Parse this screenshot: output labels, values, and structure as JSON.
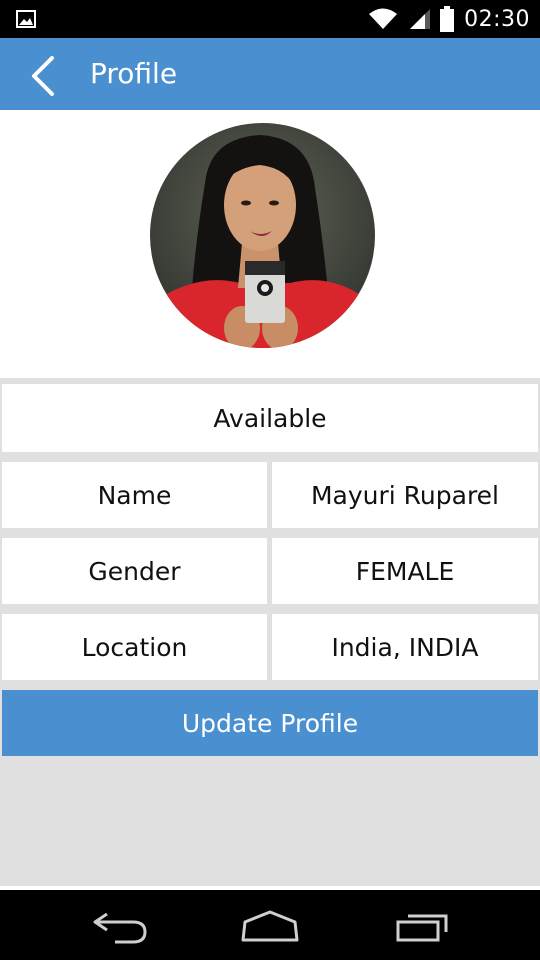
{
  "status_bar": {
    "time": "02:30",
    "icons": [
      "gallery-icon",
      "wifi-icon",
      "signal-icon",
      "battery-icon"
    ]
  },
  "app_bar": {
    "title": "Profile",
    "back_icon": "chevron-left-icon",
    "color": "#4a8fd0"
  },
  "profile": {
    "status": "Available",
    "fields": [
      {
        "label": "Name",
        "value": "Mayuri Ruparel"
      },
      {
        "label": "Gender",
        "value": "FEMALE"
      },
      {
        "label": "Location",
        "value": "India, INDIA"
      }
    ]
  },
  "actions": {
    "update_label": "Update Profile",
    "button_color": "#4a8fd0"
  },
  "nav_bar": {
    "icons": [
      "back-nav-icon",
      "home-nav-icon",
      "recent-apps-icon"
    ]
  }
}
